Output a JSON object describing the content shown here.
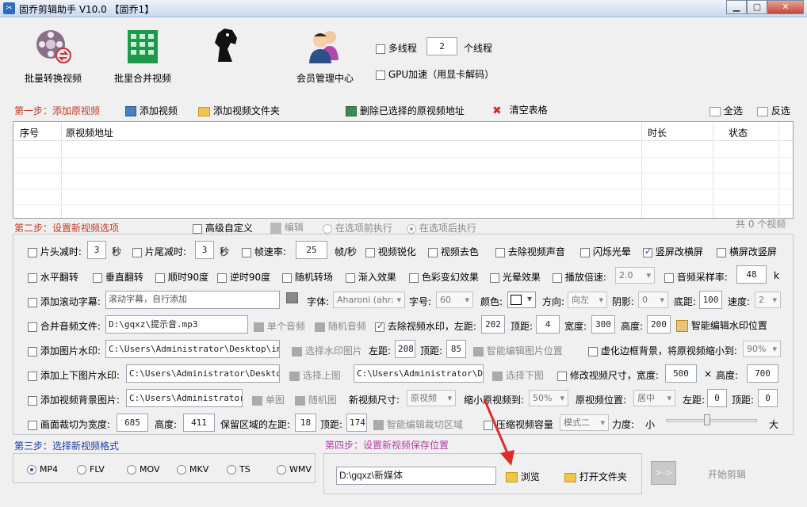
{
  "window": {
    "title": "固乔剪辑助手 V10.0 【固乔1】",
    "app_icon": "scissors-icon"
  },
  "toolbar": {
    "items": [
      {
        "label": "批量转换视频",
        "icon": "film-reel-icon"
      },
      {
        "label": "批里合并视频",
        "icon": "grid-merge-icon"
      },
      {
        "label": "",
        "icon": "horse-head-icon"
      },
      {
        "label": "会员管理中心",
        "icon": "users-icon"
      }
    ],
    "multithread": {
      "label": "多线程",
      "count": "2",
      "unit": "个线程",
      "checked": false
    },
    "gpu": {
      "label": "GPU加速（用显卡解码）",
      "checked": false
    }
  },
  "step1": {
    "title": "第一步：添加原视频",
    "add_video": "添加视频",
    "add_folder": "添加视频文件夹",
    "delete_selected": "删除已选择的原视频地址",
    "clear_table": "清空表格",
    "select_all": "全选",
    "invert": "反选"
  },
  "table": {
    "columns": [
      "序号",
      "原视频地址",
      "时长",
      "状态"
    ],
    "rows": []
  },
  "step2": {
    "title": "第二步：设置新视频选项",
    "advanced": "高级自定义",
    "edit": "编辑",
    "before": "在选项前执行",
    "after": "在选项后执行",
    "count": "共 0 个视频"
  },
  "opts": {
    "r1": {
      "head_cut": "片头减时:",
      "head_val": "3",
      "sec1": "秒",
      "tail_cut": "片尾减时:",
      "tail_val": "3",
      "sec2": "秒",
      "fps": "帧速率:",
      "fps_val": "25",
      "fps_unit": "帧/秒",
      "sharpen": "视频锐化",
      "decolor": "视频去色",
      "mute": "去除视频声音",
      "flash": "闪烁光晕",
      "v2h": "竖屏改横屏",
      "h2v": "横屏改竖屏"
    },
    "r2": {
      "hflip": "水平翻转",
      "vflip": "垂直翻转",
      "rot90": "顺时90度",
      "rot90ccw": "逆时90度",
      "random_trans": "随机转场",
      "fadein": "渐入效果",
      "color": "色彩变幻效果",
      "halo": "光晕效果",
      "speed": "播放倍速:",
      "speed_val": "2.0",
      "sample": "音频采样率:",
      "sample_val": "48",
      "sample_unit": "k"
    },
    "r3": {
      "scroll": "添加滚动字幕:",
      "scroll_val": "滚动字幕，自行添加",
      "font": "字体:",
      "font_val": "Aharoni (ahr:",
      "size": "字号:",
      "size_val": "60",
      "colorlab": "颜色:",
      "dir": "方向:",
      "dir_val": "向左",
      "shadow": "阴影:",
      "shadow_val": "0",
      "bottom": "底距:",
      "bottom_val": "100",
      "speed": "速度:",
      "speed_val": "2"
    },
    "r4": {
      "merge_audio": "合并音频文件:",
      "audio_path": "D:\\gqxz\\提示音.mp3",
      "single": "单个音频",
      "random": "随机音频",
      "remove_wm": "去除视频水印，左距:",
      "left_val": "202",
      "top": "顶距:",
      "top_val": "4",
      "width": "宽度:",
      "width_val": "300",
      "height": "高度:",
      "height_val": "200",
      "smart_wm": "智能编辑水印位置"
    },
    "r5": {
      "img_wm": "添加图片水印:",
      "img_path": "C:\\Users\\Administrator\\Desktop\\img-q",
      "choose": "选择水印图片",
      "left": "左距:",
      "left_val": "208",
      "top": "顶距:",
      "top_val": "85",
      "smart": "智能编辑图片位置",
      "blur": "虚化边框背景，将原视频缩小到:",
      "blur_val": "90%"
    },
    "r6": {
      "updown": "添加上下图片水印:",
      "up_path": "C:\\Users\\Administrator\\Desktop\\i",
      "choose_up": "选择上图",
      "down_path": "C:\\Users\\Administrator\\Desk",
      "choose_down": "选择下图",
      "resize": "修改视频尺寸，宽度:",
      "w_val": "500",
      "x": "×",
      "h": "高度:",
      "h_val": "700"
    },
    "r7": {
      "bg": "添加视频背景图片:",
      "bg_path": "C:\\Users\\Administrator\\D",
      "single": "单图",
      "random": "随机图",
      "newsize": "新视频尺寸:",
      "newsize_val": "原视频",
      "shrink": "缩小原视频到:",
      "shrink_val": "50%",
      "pos": "原视频位置:",
      "pos_val": "居中",
      "left": "左距:",
      "left_val": "0",
      "top": "顶距:",
      "top_val": "0"
    },
    "r8": {
      "crop": "画面裁切为宽度:",
      "w_val": "685",
      "h": "高度:",
      "h_val": "411",
      "keep": "保留区域的左距:",
      "left_val": "18",
      "top": "顶距:",
      "top_val": "174",
      "smart": "智能编辑裁切区域",
      "compress": "压缩视频容量",
      "mode_val": "模式二",
      "force": "力度:",
      "small": "小",
      "big": "大",
      "force_level": 0.45
    }
  },
  "step3": {
    "title": "第三步：选择新视频格式",
    "formats": [
      "MP4",
      "FLV",
      "MOV",
      "MKV",
      "TS",
      "WMV"
    ],
    "selected": "MP4"
  },
  "step4": {
    "title": "第四步：设置新视频保存位置",
    "path": "D:\\gqxz\\新媒体",
    "browse": "浏览",
    "open": "打开文件夹",
    "start": "开始剪辑"
  },
  "colors": {
    "step": "#c23a24",
    "step3": "#1c3fa8",
    "step4": "#b43fa5",
    "arrow": "#e02b2b"
  }
}
